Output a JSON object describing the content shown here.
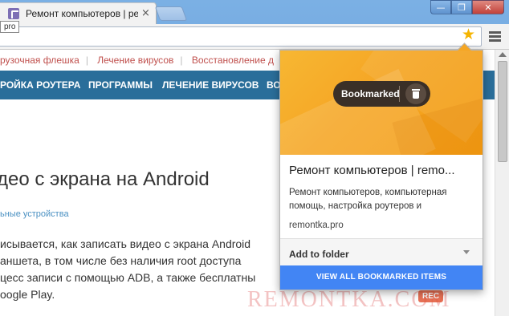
{
  "window": {
    "tab_title": "Ремонт компьютеров | ре",
    "tab_close": "×",
    "controls": {
      "minimize": "—",
      "restore": "❐",
      "close": "✕"
    }
  },
  "tooltip": "pro",
  "toolbar": {
    "star_icon": "star-icon",
    "menu_icon": "hamburger-menu-icon"
  },
  "page": {
    "top_links": [
      "рузочная флешка",
      "Лечение вирусов",
      "Восстановление д"
    ],
    "nav_items": [
      "РОЙКА РОУТЕРА",
      "ПРОГРАММЫ",
      "ЛЕЧЕНИЕ ВИРУСОВ",
      "ВО"
    ],
    "title": "део с экрана на Android",
    "breadcrumb": "ьные устройства",
    "paragraph": [
      "исывается, как записать видео с экрана Android",
      "аншета, в том числе без наличия root доступа",
      "цесс записи с помощью ADB, а также бесплатны",
      "oogle Play."
    ],
    "watermark": "REMONTKA.COM",
    "rec_badge": "REC"
  },
  "bookmark_bubble": {
    "pill_label": "Bookmarked",
    "site_title": "Ремонт компьютеров | remo...",
    "description": "Ремонт компьютеров, компьютерная помощь, настройка роутеров и",
    "url": "remontka.pro",
    "folder_label": "Add to folder",
    "view_all_label": "VIEW ALL BOOKMARKED ITEMS",
    "colors": {
      "hero": "#f5a623",
      "pill": "#3a2f27",
      "button": "#4285f4"
    }
  }
}
